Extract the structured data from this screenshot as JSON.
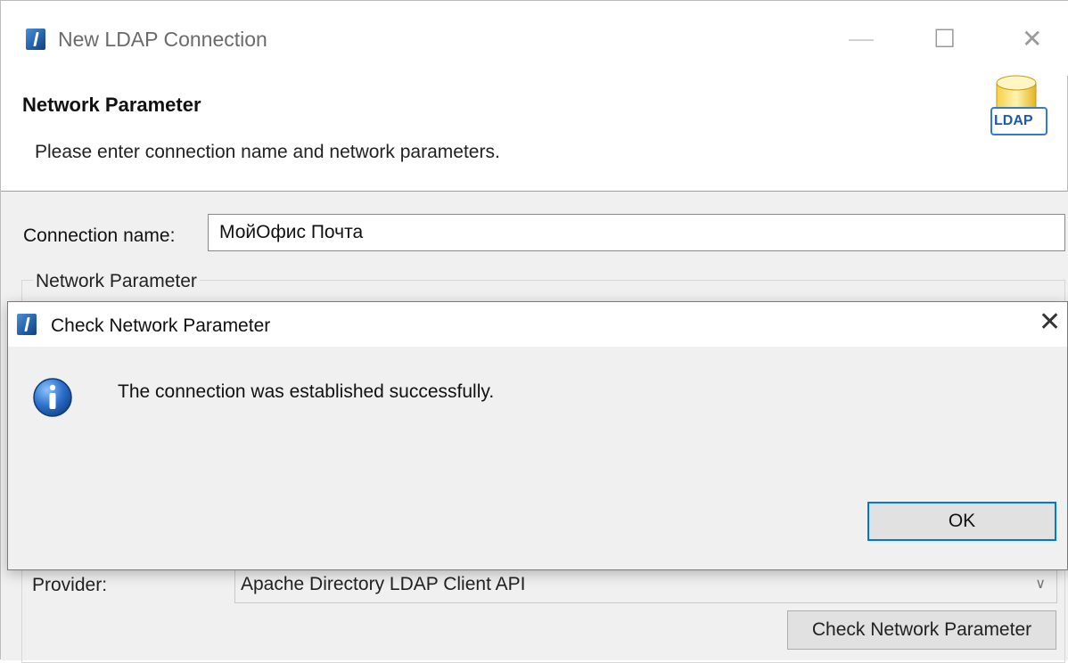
{
  "main_window": {
    "title": "New LDAP Connection",
    "controls": {
      "minimize": "—",
      "maximize": "☐",
      "close": "✕"
    },
    "header": {
      "title": "Network Parameter",
      "description": "Please enter connection name and network parameters.",
      "badge_text": "LDAP"
    },
    "form": {
      "connection_name_label": "Connection name:",
      "connection_name_value": "МойОфис Почта",
      "group_label": "Network Parameter",
      "provider_label": "Provider:",
      "provider_value": "Apache Directory LDAP Client API",
      "provider_chevron": "∨",
      "check_button": "Check Network Parameter"
    }
  },
  "dialog": {
    "title": "Check Network Parameter",
    "close_glyph": "✕",
    "message": "The connection was established successfully.",
    "ok_button": "OK",
    "icon": "info-icon"
  },
  "colors": {
    "accent": "#0078d7",
    "dialog_bg": "#f0f0f0",
    "info_blue": "#2a6fc9"
  }
}
